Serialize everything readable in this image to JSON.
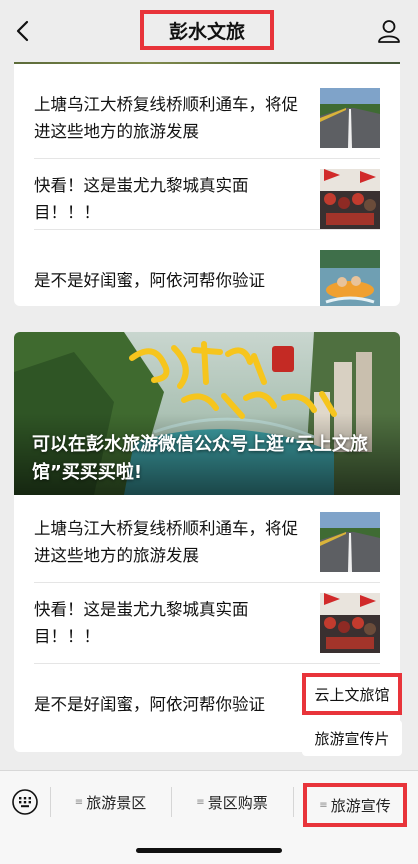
{
  "header": {
    "title": "彭水文旅",
    "back_icon": "chevron-left-icon",
    "profile_icon": "user-icon"
  },
  "group1": {
    "articles": [
      {
        "title": "上塘乌江大桥复线桥顺利通车，将促进这些地方的旅游发展",
        "thumb": "road-bridge-photo"
      },
      {
        "title": "快看！这是蚩尤九黎城真实面目！！！",
        "thumb": "festival-crowd-photo"
      },
      {
        "title": "是不是好闺蜜，阿依河帮你验证",
        "thumb": "river-rafting-photo"
      }
    ]
  },
  "group2": {
    "hero": {
      "caption": "可以在彭水旅游微信公众号上逛“云上文旅馆”买买买啦!",
      "calligraphy": "世外苗乡 养心彭水"
    },
    "articles": [
      {
        "title": "上塘乌江大桥复线桥顺利通车，将促进这些地方的旅游发展",
        "thumb": "road-bridge-photo"
      },
      {
        "title": "快看！这是蚩尤九黎城真实面目！！！",
        "thumb": "festival-crowd-photo"
      },
      {
        "title": "是不是好闺蜜，阿依河帮你验证",
        "thumb": ""
      }
    ]
  },
  "popup_menu": {
    "items": [
      {
        "label": "云上文旅馆"
      },
      {
        "label": "旅游宣传片"
      }
    ]
  },
  "bottom_menu": {
    "keyboard_icon": "keyboard-icon",
    "tabs": [
      {
        "label": "旅游景区"
      },
      {
        "label": "景区购票"
      },
      {
        "label": "旅游宣传"
      }
    ]
  },
  "colors": {
    "highlight": "#e8343a",
    "background": "#ededed",
    "card": "#ffffff"
  }
}
